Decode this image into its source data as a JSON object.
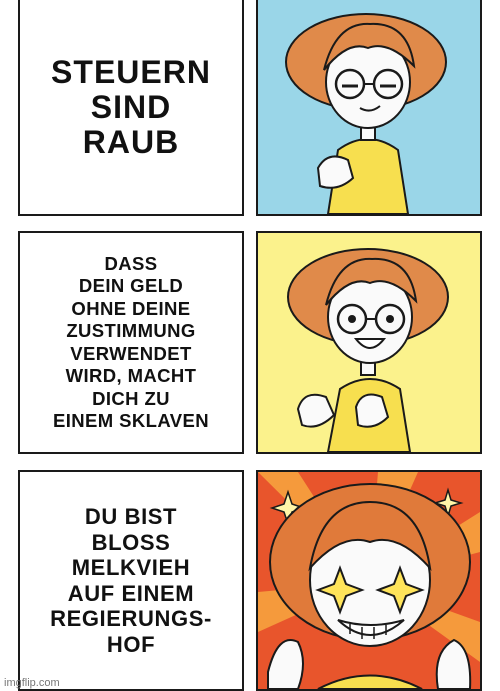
{
  "meme": {
    "panels": [
      {
        "caption": "STEUERN\nSIND\nRAUB",
        "image": "girl-smug-thumbs-up",
        "background": "#9ad6e8"
      },
      {
        "caption": "DASS\nDEIN GELD\nOHNE DEINE\nZUSTIMMUNG\nVERWENDET\nWIRD, MACHT\nDICH ZU\nEINEM SKLAVEN",
        "image": "girl-double-thumbs-up",
        "background": "#fbf28c"
      },
      {
        "caption": "DU BIST\nBLOSS\nMELKVIEH\nAUF EINEM\nREGIERUNGS-\nHOF",
        "image": "girl-ecstatic-sparkle-eyes",
        "background": "#e8552c"
      }
    ],
    "watermark": "imgflip.com"
  },
  "colors": {
    "hair": "#e08a4a",
    "hair_dark": "#b8612e",
    "shirt": "#f7df4f",
    "skin": "#fafafa",
    "outline": "#1a1a1a"
  }
}
